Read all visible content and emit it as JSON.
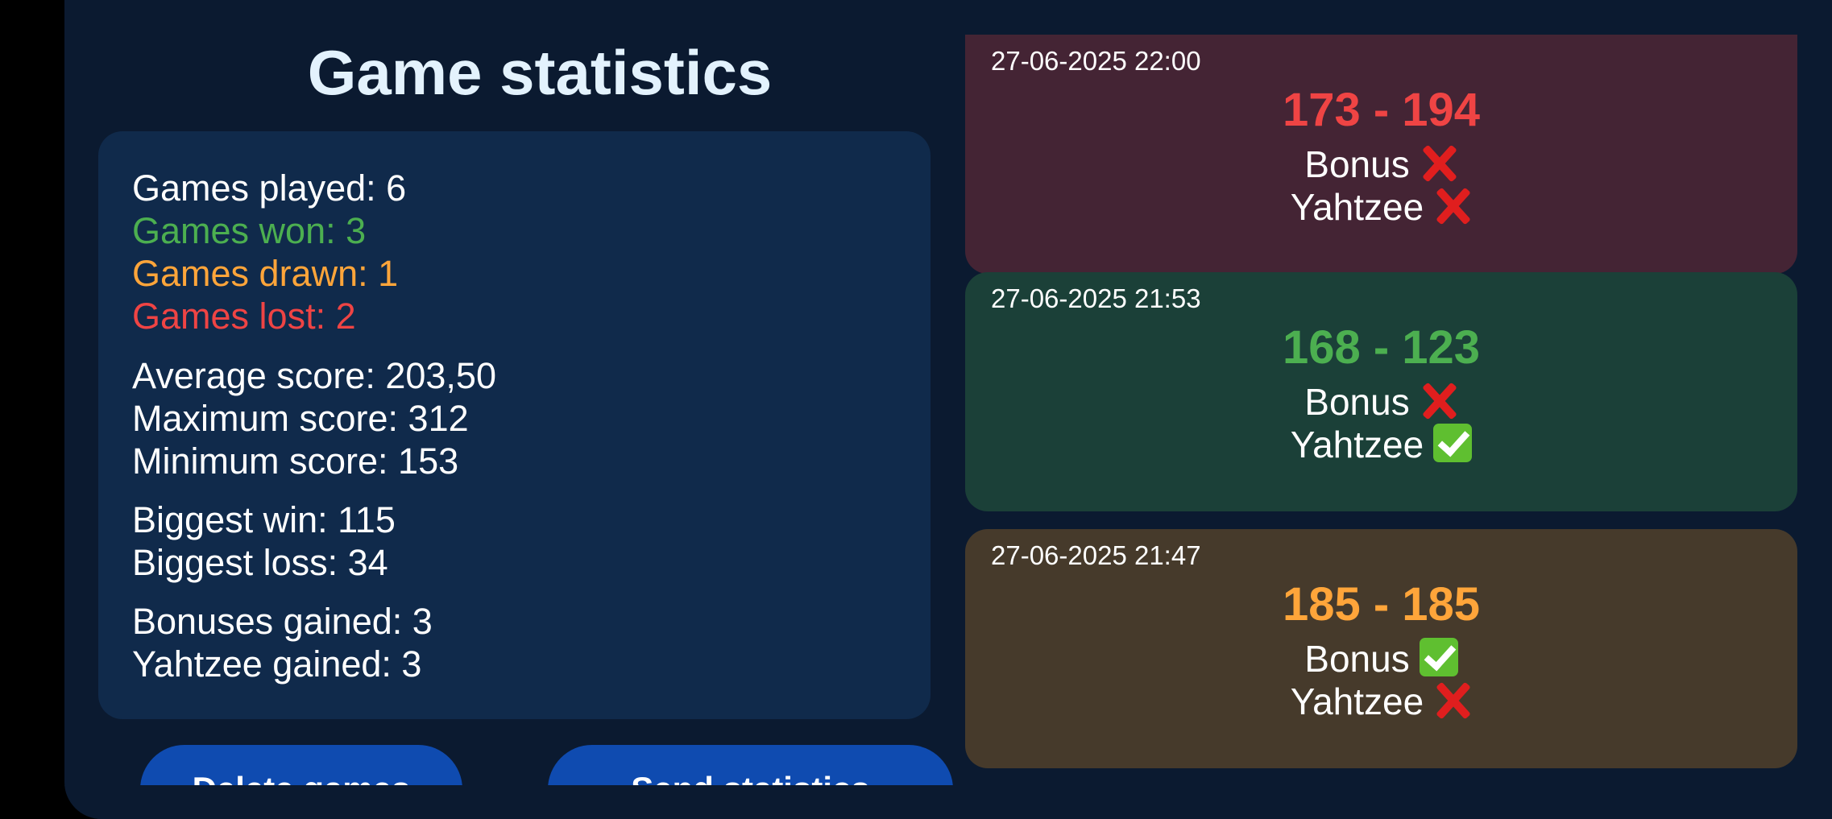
{
  "title": "Game statistics",
  "stats": {
    "games_played": "Games played: 6",
    "games_won": "Games won: 3",
    "games_drawn": "Games drawn: 1",
    "games_lost": "Games lost: 2",
    "average_score": "Average score: 203,50",
    "maximum_score": "Maximum score: 312",
    "minimum_score": "Minimum score: 153",
    "biggest_win": "Biggest win: 115",
    "biggest_loss": "Biggest loss: 34",
    "bonuses_gained": "Bonuses gained: 3",
    "yahtzee_gained": "Yahtzee gained: 3"
  },
  "buttons": {
    "delete_label": "Delete games",
    "send_label": "Send statistics"
  },
  "games": [
    {
      "date": "27-06-2025 22:00",
      "score": "173 - 194",
      "result": "loss",
      "bonus_label": "Bonus",
      "bonus_icon": "cross-mark-icon",
      "yahtzee_label": "Yahtzee",
      "yahtzee_icon": "cross-mark-icon"
    },
    {
      "date": "27-06-2025 21:53",
      "score": "168 - 123",
      "result": "win",
      "bonus_label": "Bonus",
      "bonus_icon": "cross-mark-icon",
      "yahtzee_label": "Yahtzee",
      "yahtzee_icon": "check-mark-icon"
    },
    {
      "date": "27-06-2025 21:47",
      "score": "185 - 185",
      "result": "draw",
      "bonus_label": "Bonus",
      "bonus_icon": "check-mark-icon",
      "yahtzee_label": "Yahtzee",
      "yahtzee_icon": "cross-mark-icon"
    }
  ],
  "colors": {
    "background": "#0b1a30",
    "panel": "#102a4b",
    "win": "#4caf50",
    "draw": "#ffa53a",
    "loss": "#ef4444",
    "button": "#0f4bb0",
    "loss_card": "#442434",
    "win_card": "#1b4038",
    "draw_card": "#463a2b"
  }
}
